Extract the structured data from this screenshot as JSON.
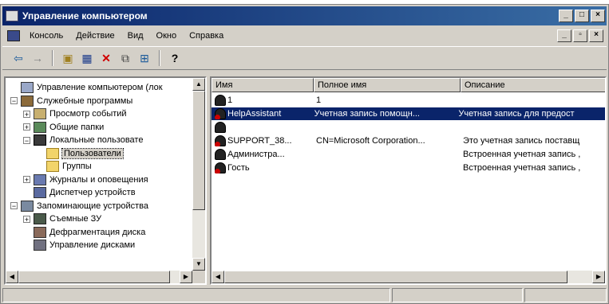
{
  "window": {
    "title": "Управление компьютером",
    "buttons": [
      "_",
      "□",
      "×"
    ]
  },
  "menubar": {
    "items": [
      {
        "label": "Консоль"
      },
      {
        "label": "Действие"
      },
      {
        "label": "Вид"
      },
      {
        "label": "Окно"
      },
      {
        "label": "Справка"
      }
    ],
    "mdi_buttons": [
      "_",
      "▫",
      "×"
    ]
  },
  "toolbar": {
    "buttons": [
      {
        "name": "back-arrow-icon",
        "glyph": "⇦"
      },
      {
        "name": "forward-arrow-icon",
        "glyph": "→"
      },
      {
        "name": "up-folder-icon",
        "glyph": "▣"
      },
      {
        "name": "show-hide-tree-icon",
        "glyph": "▦"
      },
      {
        "name": "delete-icon",
        "glyph": "✕"
      },
      {
        "name": "properties-icon",
        "glyph": "⧉"
      },
      {
        "name": "export-list-icon",
        "glyph": "⊞"
      },
      {
        "name": "help-icon",
        "glyph": "?"
      }
    ]
  },
  "tree": {
    "items": [
      {
        "label": "Управление компьютером (лок",
        "level": 0,
        "expander": "",
        "icon": "ic-comp",
        "icon_name": "computer-management-icon"
      },
      {
        "label": "Служебные программы",
        "level": 0,
        "expander": "−",
        "icon": "ic-tools",
        "icon_name": "system-tools-icon"
      },
      {
        "label": "Просмотр событий",
        "level": 1,
        "expander": "+",
        "icon": "ic-ev",
        "icon_name": "event-viewer-icon"
      },
      {
        "label": "Общие папки",
        "level": 1,
        "expander": "+",
        "icon": "ic-share",
        "icon_name": "shared-folders-icon"
      },
      {
        "label": "Локальные пользовате",
        "level": 1,
        "expander": "−",
        "icon": "ic-users",
        "icon_name": "local-users-icon"
      },
      {
        "label": "Пользователи",
        "level": 2,
        "expander": "",
        "icon": "ic-folder",
        "icon_name": "folder-icon",
        "selected": true
      },
      {
        "label": "Группы",
        "level": 2,
        "expander": "",
        "icon": "ic-folder",
        "icon_name": "folder-icon"
      },
      {
        "label": "Журналы и оповещения",
        "level": 1,
        "expander": "+",
        "icon": "ic-logs",
        "icon_name": "performance-logs-icon"
      },
      {
        "label": "Диспетчер устройств",
        "level": 1,
        "expander": "",
        "icon": "ic-dev",
        "icon_name": "device-manager-icon"
      },
      {
        "label": "Запоминающие устройства",
        "level": 0,
        "expander": "−",
        "icon": "ic-store",
        "icon_name": "storage-icon"
      },
      {
        "label": "Съемные ЗУ",
        "level": 1,
        "expander": "+",
        "icon": "ic-rem",
        "icon_name": "removable-storage-icon"
      },
      {
        "label": "Дефрагментация диска",
        "level": 1,
        "expander": "",
        "icon": "ic-defrag",
        "icon_name": "defrag-icon"
      },
      {
        "label": "Управление дисками",
        "level": 1,
        "expander": "",
        "icon": "ic-disk",
        "icon_name": "disk-management-icon"
      }
    ]
  },
  "list": {
    "columns": [
      "Имя",
      "Полное имя",
      "Описание"
    ],
    "rows": [
      {
        "name": "1",
        "full_name": "1",
        "description": "",
        "disabled": false
      },
      {
        "name": "HelpAssistant",
        "full_name": "Учетная запись помощн...",
        "description": "Учетная запись для предост",
        "disabled": true,
        "selected": true
      },
      {
        "name": "",
        "full_name": "",
        "description": "",
        "disabled": false
      },
      {
        "name": "SUPPORT_38...",
        "full_name": "CN=Microsoft Corporation...",
        "description": "Это учетная запись поставщ",
        "disabled": true
      },
      {
        "name": "Администра...",
        "full_name": "",
        "description": "Встроенная учетная запись ,",
        "disabled": false
      },
      {
        "name": "Гость",
        "full_name": "",
        "description": "Встроенная учетная запись ,",
        "disabled": true
      }
    ]
  }
}
